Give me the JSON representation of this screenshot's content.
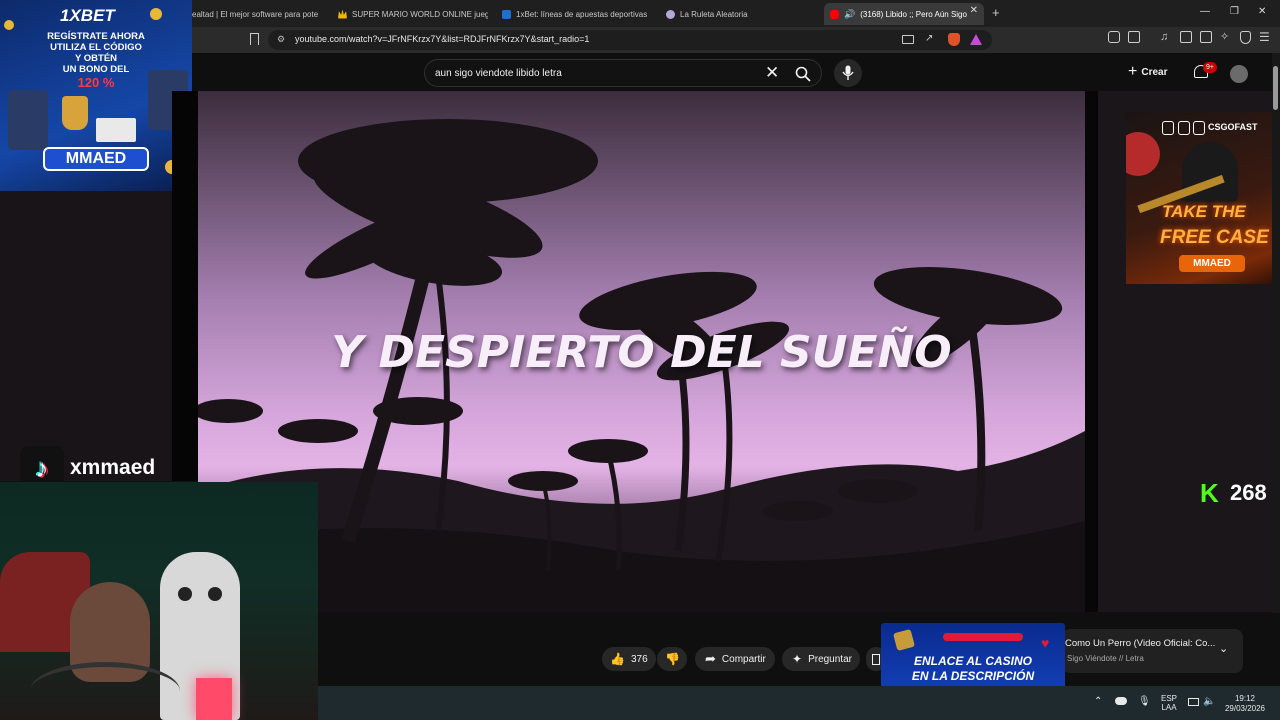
{
  "browser": {
    "tabs": [
      {
        "label": "ealtad | El mejor software para pote",
        "favicon_color": "#3a3a3a"
      },
      {
        "label": "SUPER MARIO WORLD ONLINE jueg",
        "favicon_color": "#f2b600"
      },
      {
        "label": "1xBet: líneas de apuestas deportivas",
        "favicon_color": "#1d6fd1"
      },
      {
        "label": "La Ruleta Aleatoria",
        "favicon_color": "#b7a7d8"
      },
      {
        "label": "(3168) Libido ;; Pero Aún Sigo",
        "favicon_color": "#ff0000",
        "active": true
      }
    ],
    "new_tab_icon": "+",
    "url": "youtube.com/watch?v=JFrNFKrzx7Y&list=RDJFrNFKrzx7Y&start_radio=1"
  },
  "youtube": {
    "search_query": "aun sigo viendote libido letra",
    "create_label": "Crear",
    "notification_badge": "9+",
    "video": {
      "lyric": "Y DESPIERTO DEL SUEÑO"
    },
    "actions": {
      "likes": "376",
      "share_label": "Compartir",
      "ask_label": "Preguntar"
    },
    "playlist": {
      "title": "Como Un Perro (Video Oficial: Co...",
      "subtitle": "Sigo Viéndote // Letra"
    }
  },
  "overlays": {
    "xbet": {
      "logo": "1XBET",
      "line1": "REGÍSTRATE AHORA",
      "line2": "UTILIZA EL CÓDIGO",
      "line3": "Y OBTÉN",
      "line4": "UN BONO DEL",
      "percent": "120 %",
      "code": "MMAED"
    },
    "tiktok": {
      "username": "xmmaed"
    },
    "csgo": {
      "logo": "CSGOFAST",
      "line1": "TAKE THE",
      "line2": "FREE CASE",
      "code": "MMAED"
    },
    "kick": {
      "letter": "K",
      "viewers": "268"
    },
    "casino": {
      "line1": "ENLACE AL CASINO",
      "line2": "EN LA DESCRIPCIÓN"
    }
  },
  "taskbar": {
    "lang1": "ESP",
    "lang2": "LAA",
    "time": "19:12",
    "date": "29/03/2026"
  }
}
